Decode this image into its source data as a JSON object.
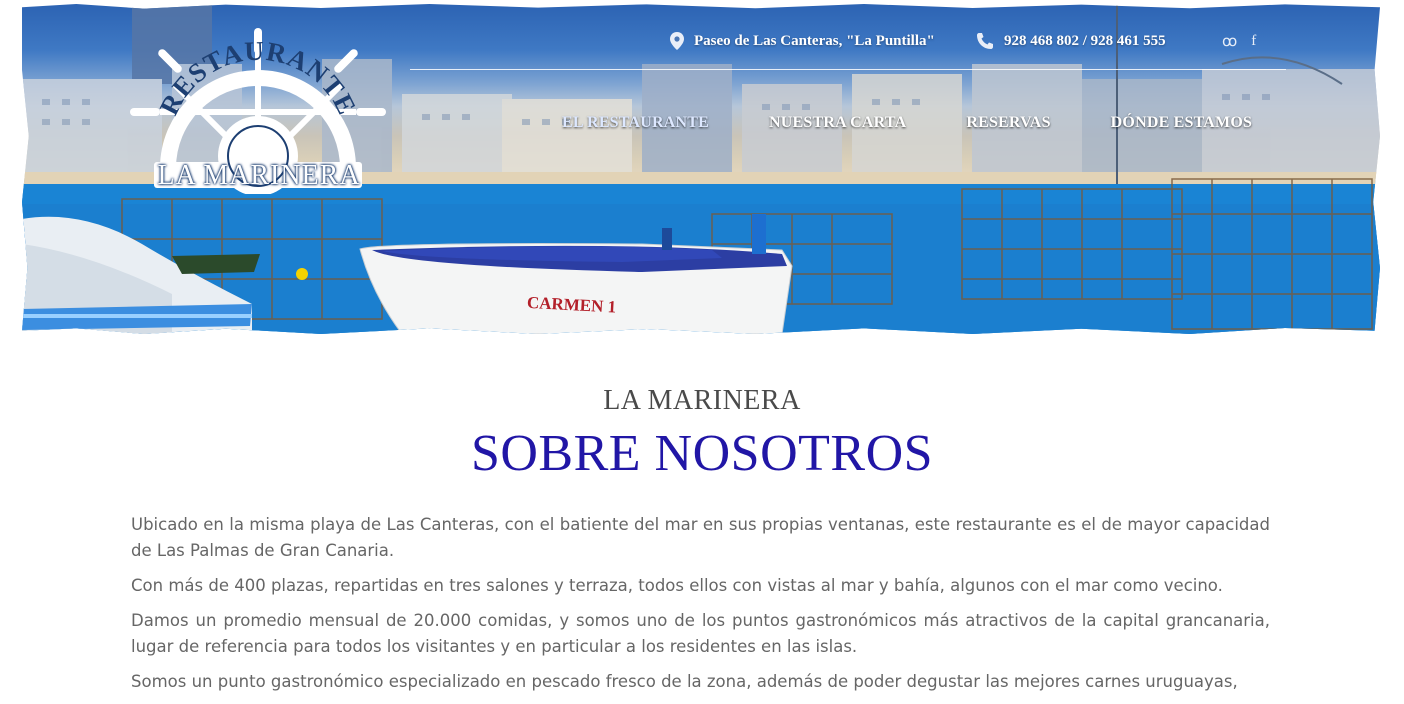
{
  "header": {
    "address": "Paseo de Las Canteras, \"La Puntilla\"",
    "phone": "928 468 802 / 928 461 555",
    "social": [
      {
        "name": "tripadvisor-icon",
        "glyph": "ꝏ"
      },
      {
        "name": "facebook-icon",
        "glyph": "f"
      }
    ],
    "logo": {
      "top_text": "RESTAURANTE",
      "bottom_text": "LA MARINERA"
    },
    "nav": [
      {
        "label": "EL RESTAURANTE",
        "active": true
      },
      {
        "label": "NUESTRA CARTA",
        "active": false
      },
      {
        "label": "RESERVAS",
        "active": false
      },
      {
        "label": "DÓNDE ESTAMOS",
        "active": false
      }
    ],
    "boat_name": "CARMEN 1"
  },
  "main": {
    "subtitle": "LA MARINERA",
    "title": "SOBRE NOSOTROS",
    "paragraphs": [
      "Ubicado en la misma playa de Las Canteras, con el batiente del mar en sus propias ventanas, este restaurante es el de mayor capacidad de Las Palmas de Gran Canaria.",
      "Con más de 400 plazas, repartidas en tres salones y terraza, todos ellos con vistas al mar y bahía, algunos con el mar como vecino.",
      "Damos un promedio mensual de 20.000 comidas, y somos uno de los puntos gastronómicos más atractivos de la capital grancanaria, lugar de referencia para todos los visitantes y en particular a los residentes en las islas.",
      "Somos un punto gastronómico especializado en pescado fresco de la zona, además de poder degustar las mejores carnes uruguayas,"
    ]
  },
  "colors": {
    "title": "#2116a6",
    "subtitle": "#4a4a4a",
    "body_text": "#666666",
    "sea": "#1a7fd0",
    "sky": "#2c63b3"
  }
}
